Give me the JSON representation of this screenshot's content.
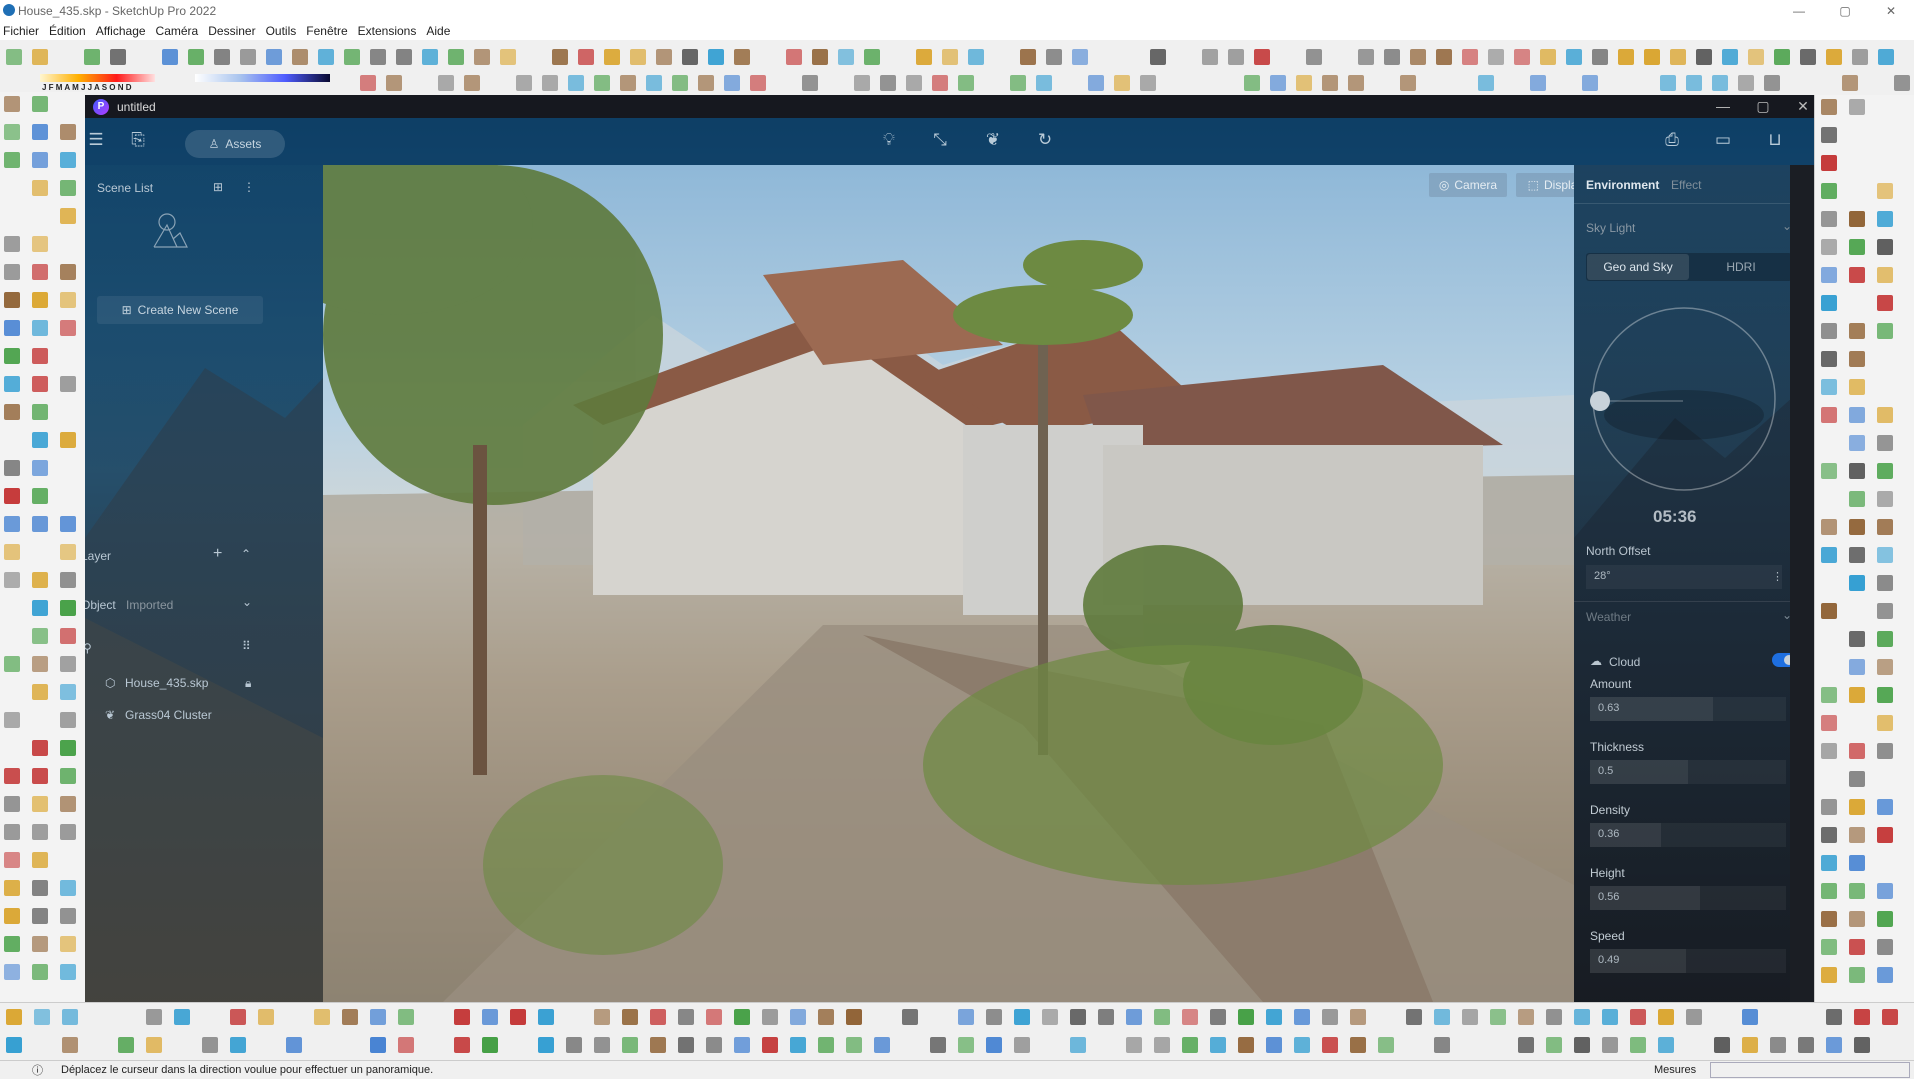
{
  "window": {
    "title": "House_435.skp - SketchUp Pro 2022",
    "controls": [
      "—",
      "▢",
      "✕"
    ]
  },
  "menu": [
    "Fichier",
    "Édition",
    "Affichage",
    "Caméra",
    "Dessiner",
    "Outils",
    "Fenêtre",
    "Extensions",
    "Aide"
  ],
  "toolbar": {
    "month_scale": "J F M A M J J A S O N D"
  },
  "plugin": {
    "title": "untitled",
    "logo": "P",
    "header": {
      "assets_label": "Assets",
      "icons": [
        "menu-icon",
        "file-export-icon",
        "lightbulb-icon",
        "path-icon",
        "leaf-icon",
        "rotate-icon",
        "screenshot-camera-icon",
        "video-icon",
        "inbox-icon"
      ]
    },
    "left": {
      "scene_list": "Scene List",
      "create_scene": "Create New Scene",
      "layer": "Layer",
      "object_tab": "Object",
      "imported_tab": "Imported",
      "objects": [
        {
          "name": "House_435.skp",
          "icon": "cube-icon"
        },
        {
          "name": "Grass04 Cluster",
          "icon": "leaf-icon"
        }
      ]
    },
    "viewport": {
      "camera_label": "Camera",
      "display_label": "Display"
    },
    "right": {
      "tabs": [
        "Environment",
        "Effect"
      ],
      "active_tab": "Environment",
      "sky_light": "Sky Light",
      "sky_modes": [
        "Geo and Sky",
        "HDRI"
      ],
      "active_mode": "Geo and Sky",
      "time": "05:36",
      "north_offset_label": "North Offset",
      "north_offset": "28°",
      "weather": "Weather",
      "cloud_label": "Cloud",
      "cloud_enabled": true,
      "sliders": [
        {
          "label": "Amount",
          "value": "0.63",
          "fraction": 0.63
        },
        {
          "label": "Thickness",
          "value": "0.5",
          "fraction": 0.5
        },
        {
          "label": "Density",
          "value": "0.36",
          "fraction": 0.36
        },
        {
          "label": "Height",
          "value": "0.56",
          "fraction": 0.56
        },
        {
          "label": "Speed",
          "value": "0.49",
          "fraction": 0.49
        }
      ],
      "accent": "#1e6fe0"
    }
  },
  "status": {
    "message": "Déplacez le curseur dans la direction voulue pour effectuer un panoramique.",
    "measures_label": "Mesures"
  }
}
